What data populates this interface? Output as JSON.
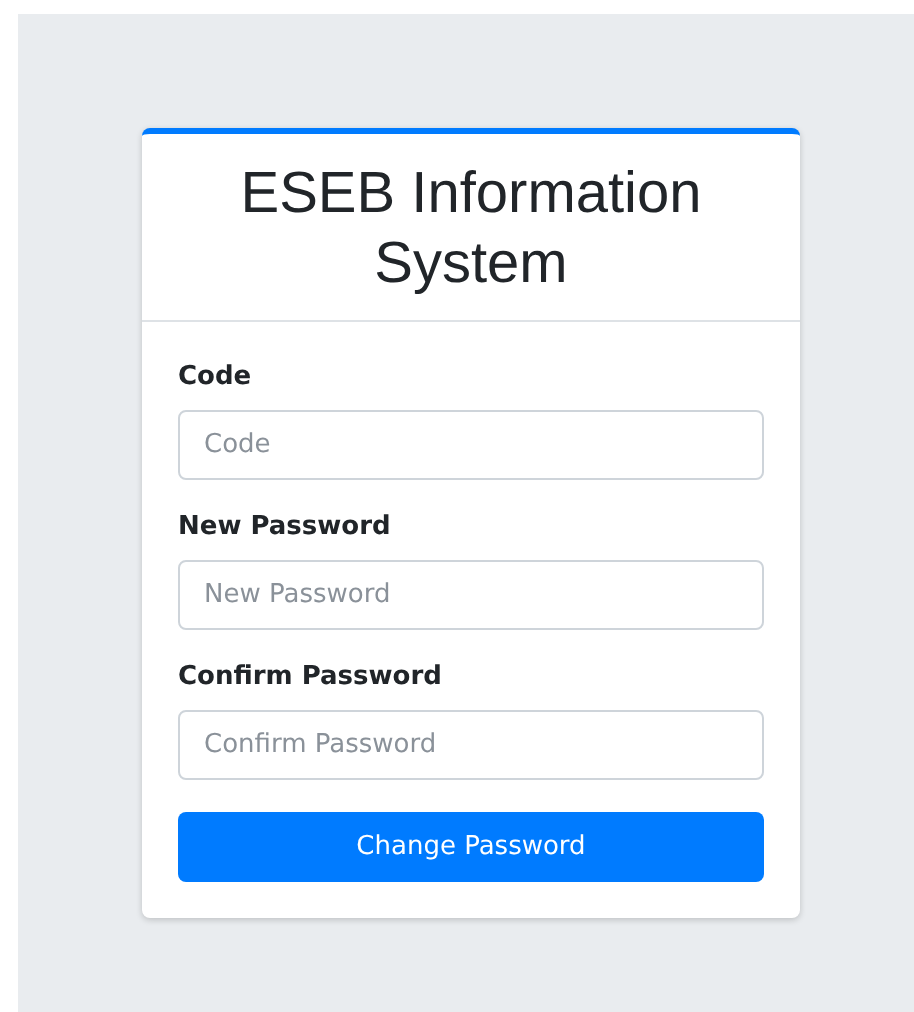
{
  "card": {
    "title": "ESEB Information System",
    "fields": [
      {
        "label": "Code",
        "placeholder": "Code"
      },
      {
        "label": "New Password",
        "placeholder": "New Password"
      },
      {
        "label": "Confirm Password",
        "placeholder": "Confirm Password"
      }
    ],
    "button": "Change Password"
  }
}
